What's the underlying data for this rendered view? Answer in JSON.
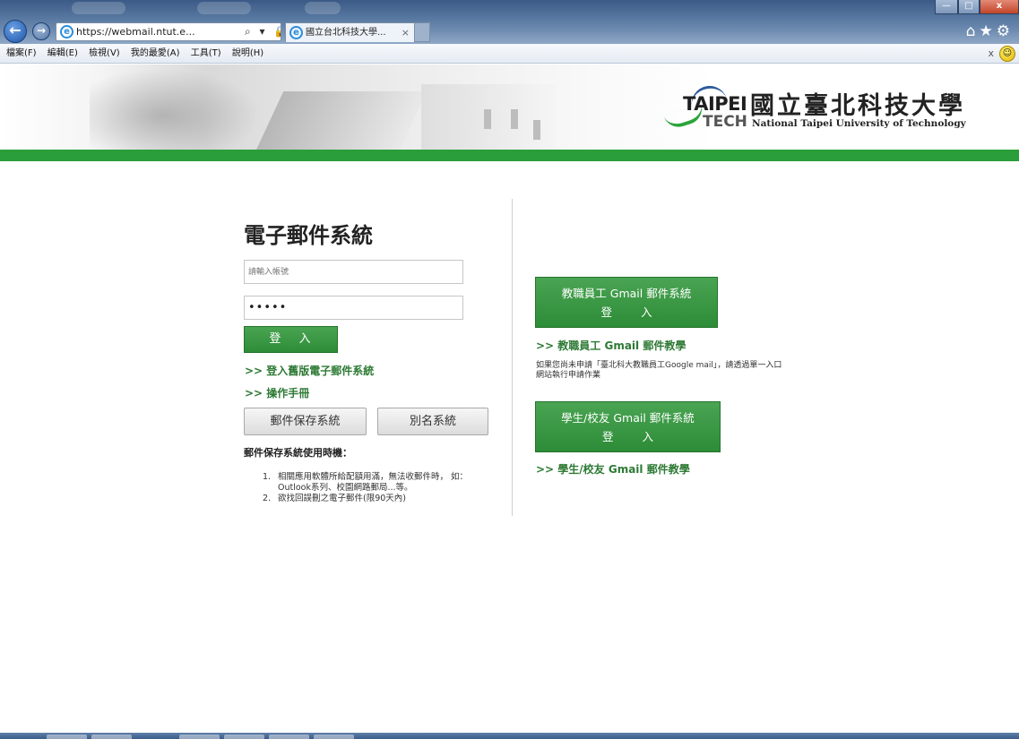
{
  "browser": {
    "address": "https://webmail.ntut.e...",
    "address_tools": "⌕ ▾ 🔒 ⚠ ↻ ✕",
    "tab_title": "國立台北科技大學...",
    "tab_close": "×",
    "window_min": "—",
    "window_max": "□",
    "window_close": "x",
    "right_icons": "⌂★⚙",
    "menu": [
      "檔案(F)",
      "編輯(E)",
      "檢視(V)",
      "我的最愛(A)",
      "工具(T)",
      "說明(H)"
    ],
    "menu_close": "x"
  },
  "header": {
    "logo_taipei": "TAIPEI",
    "logo_tech": "TECH",
    "logo_cn": "國立臺北科技大學",
    "logo_en": "National Taipei University of Technology",
    "accent_color": "#2a9e3a"
  },
  "login": {
    "title": "電子郵件系統",
    "username_placeholder": "請輸入帳號",
    "password_value": "•••••",
    "login_button": "登 入",
    "old_webmail_link": ">> 登入舊版電子郵件系統",
    "manual_link": ">> 操作手冊",
    "archive_button": "郵件保存系統",
    "alias_button": "別名系統",
    "usage_title": "郵件保存系統使用時機：",
    "usage_items": [
      {
        "num": "1.",
        "text": "相關應用軟體所給配額用滿，無法收郵件時， 如：Outlook系列、校園網路郵局...等。"
      },
      {
        "num": "2.",
        "text": "欲找回誤刪之電子郵件(限90天內)"
      }
    ]
  },
  "gmail": {
    "staff_button_line1": "教職員工 Gmail 郵件系統",
    "staff_button_line2": "登 入",
    "staff_tutorial": ">> 教職員工 Gmail 郵件教學",
    "note": "如果您尚未申請「臺北科大教職員工Google mail」，請透過單一入口網站執行申請作業",
    "student_button_line1": "學生/校友 Gmail 郵件系統",
    "student_button_line2": "登 入",
    "student_tutorial": ">> 學生/校友 Gmail 郵件教學"
  }
}
